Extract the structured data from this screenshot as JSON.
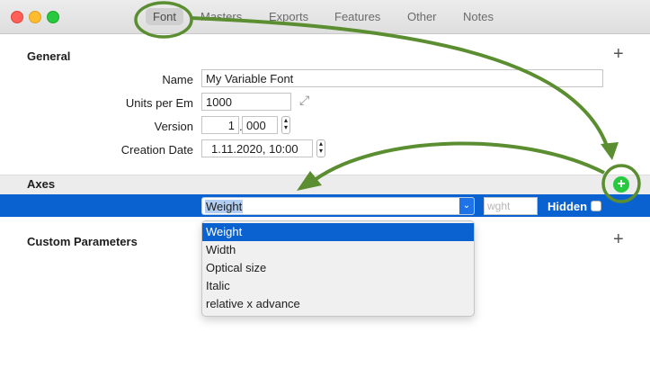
{
  "window": {
    "tabs": [
      {
        "label": "Font",
        "active": true
      },
      {
        "label": "Masters"
      },
      {
        "label": "Exports"
      },
      {
        "label": "Features"
      },
      {
        "label": "Other"
      },
      {
        "label": "Notes"
      }
    ]
  },
  "general": {
    "title": "General",
    "name_label": "Name",
    "name_value": "My Variable Font",
    "upm_label": "Units per Em",
    "upm_value": "1000",
    "version_label": "Version",
    "version_major": "1",
    "version_sep": ".",
    "version_minor": "000",
    "date_label": "Creation Date",
    "date_value": "1.11.2020, 10:00"
  },
  "axes": {
    "title": "Axes",
    "selected_axis": "Weight",
    "tag_placeholder": "wght",
    "hidden_label": "Hidden",
    "dropdown_options": [
      "Weight",
      "Width",
      "Optical size",
      "Italic",
      "relative x advance"
    ]
  },
  "custom": {
    "title": "Custom Parameters"
  },
  "icons": {
    "plus": "+",
    "expand": "⤢",
    "chevron": "⌄"
  },
  "colors": {
    "selection_blue": "#0a62d0",
    "annotation_green": "#5b8e31",
    "add_green": "#28c840"
  }
}
